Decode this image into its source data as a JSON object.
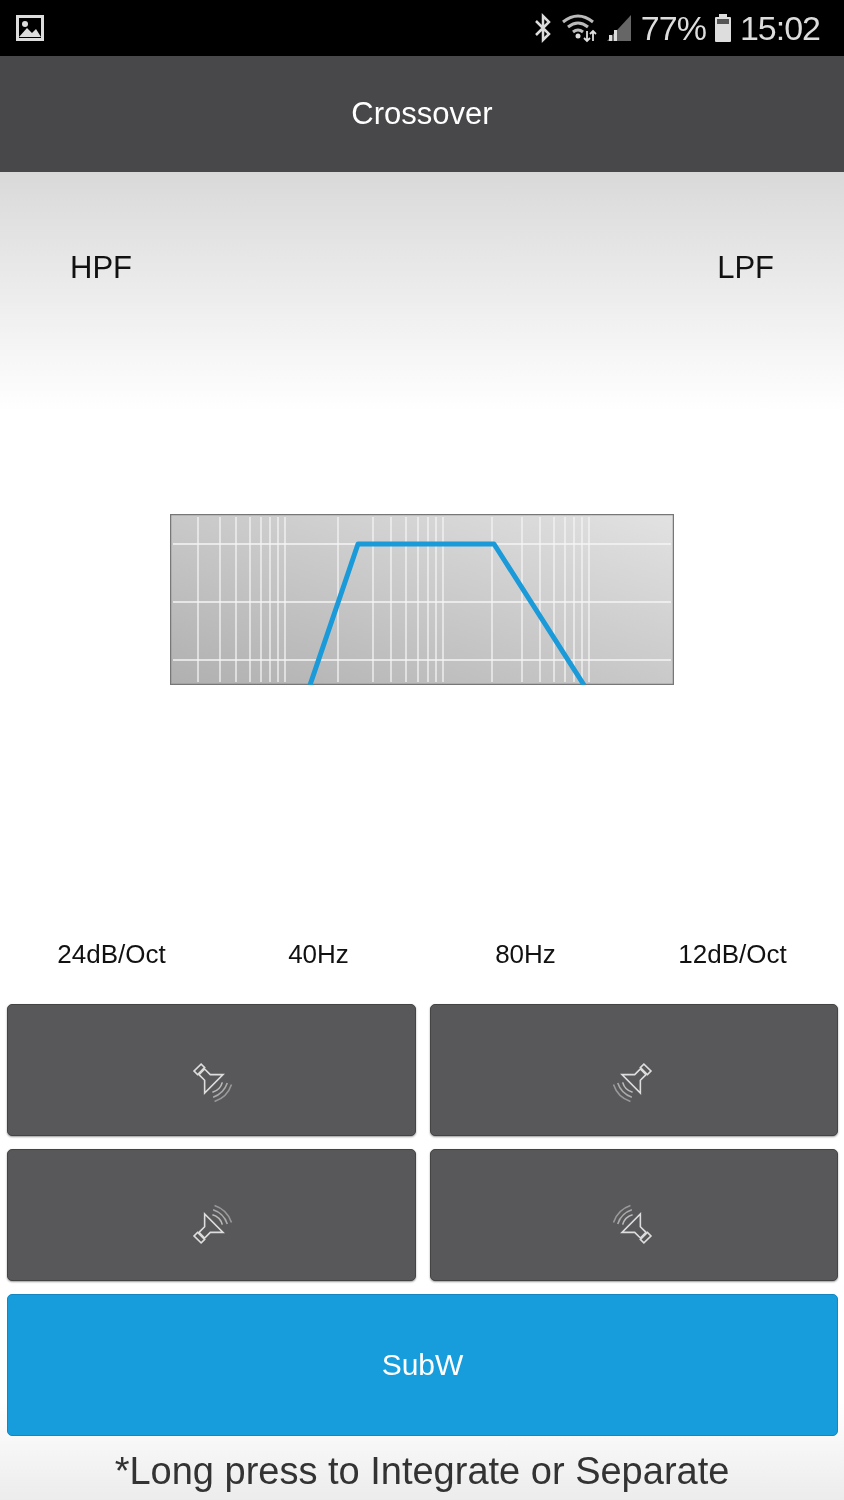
{
  "status_bar": {
    "battery": "77%",
    "time": "15:02"
  },
  "header": {
    "title": "Crossover"
  },
  "filters": {
    "left": "HPF",
    "right": "LPF"
  },
  "settings": [
    "24dB/Oct",
    "40Hz",
    "80Hz",
    "12dB/Oct"
  ],
  "speaker_buttons": [
    {
      "kind": "front_left"
    },
    {
      "kind": "front_right"
    },
    {
      "kind": "rear_left"
    },
    {
      "kind": "rear_right"
    }
  ],
  "channel_button": {
    "label": "SubW",
    "selected": true
  },
  "footer_note": "*Long press to Integrate or Separate"
}
